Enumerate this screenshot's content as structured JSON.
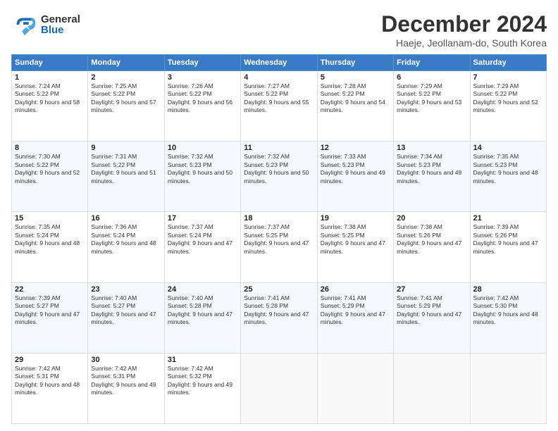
{
  "header": {
    "logo_general": "General",
    "logo_blue": "Blue",
    "main_title": "December 2024",
    "subtitle": "Haeje, Jeollanam-do, South Korea"
  },
  "weekdays": [
    "Sunday",
    "Monday",
    "Tuesday",
    "Wednesday",
    "Thursday",
    "Friday",
    "Saturday"
  ],
  "weeks": [
    [
      {
        "day": "1",
        "sunrise": "7:24 AM",
        "sunset": "5:22 PM",
        "daylight": "9 hours and 58 minutes."
      },
      {
        "day": "2",
        "sunrise": "7:25 AM",
        "sunset": "5:22 PM",
        "daylight": "9 hours and 57 minutes."
      },
      {
        "day": "3",
        "sunrise": "7:26 AM",
        "sunset": "5:22 PM",
        "daylight": "9 hours and 56 minutes."
      },
      {
        "day": "4",
        "sunrise": "7:27 AM",
        "sunset": "5:22 PM",
        "daylight": "9 hours and 55 minutes."
      },
      {
        "day": "5",
        "sunrise": "7:28 AM",
        "sunset": "5:22 PM",
        "daylight": "9 hours and 54 minutes."
      },
      {
        "day": "6",
        "sunrise": "7:29 AM",
        "sunset": "5:22 PM",
        "daylight": "9 hours and 53 minutes."
      },
      {
        "day": "7",
        "sunrise": "7:29 AM",
        "sunset": "5:22 PM",
        "daylight": "9 hours and 52 minutes."
      }
    ],
    [
      {
        "day": "8",
        "sunrise": "7:30 AM",
        "sunset": "5:22 PM",
        "daylight": "9 hours and 52 minutes."
      },
      {
        "day": "9",
        "sunrise": "7:31 AM",
        "sunset": "5:22 PM",
        "daylight": "9 hours and 51 minutes."
      },
      {
        "day": "10",
        "sunrise": "7:32 AM",
        "sunset": "5:23 PM",
        "daylight": "9 hours and 50 minutes."
      },
      {
        "day": "11",
        "sunrise": "7:32 AM",
        "sunset": "5:23 PM",
        "daylight": "9 hours and 50 minutes."
      },
      {
        "day": "12",
        "sunrise": "7:33 AM",
        "sunset": "5:23 PM",
        "daylight": "9 hours and 49 minutes."
      },
      {
        "day": "13",
        "sunrise": "7:34 AM",
        "sunset": "5:23 PM",
        "daylight": "9 hours and 49 minutes."
      },
      {
        "day": "14",
        "sunrise": "7:35 AM",
        "sunset": "5:23 PM",
        "daylight": "9 hours and 48 minutes."
      }
    ],
    [
      {
        "day": "15",
        "sunrise": "7:35 AM",
        "sunset": "5:24 PM",
        "daylight": "9 hours and 48 minutes."
      },
      {
        "day": "16",
        "sunrise": "7:36 AM",
        "sunset": "5:24 PM",
        "daylight": "9 hours and 48 minutes."
      },
      {
        "day": "17",
        "sunrise": "7:37 AM",
        "sunset": "5:24 PM",
        "daylight": "9 hours and 47 minutes."
      },
      {
        "day": "18",
        "sunrise": "7:37 AM",
        "sunset": "5:25 PM",
        "daylight": "9 hours and 47 minutes."
      },
      {
        "day": "19",
        "sunrise": "7:38 AM",
        "sunset": "5:25 PM",
        "daylight": "9 hours and 47 minutes."
      },
      {
        "day": "20",
        "sunrise": "7:38 AM",
        "sunset": "5:26 PM",
        "daylight": "9 hours and 47 minutes."
      },
      {
        "day": "21",
        "sunrise": "7:39 AM",
        "sunset": "5:26 PM",
        "daylight": "9 hours and 47 minutes."
      }
    ],
    [
      {
        "day": "22",
        "sunrise": "7:39 AM",
        "sunset": "5:27 PM",
        "daylight": "9 hours and 47 minutes."
      },
      {
        "day": "23",
        "sunrise": "7:40 AM",
        "sunset": "5:27 PM",
        "daylight": "9 hours and 47 minutes."
      },
      {
        "day": "24",
        "sunrise": "7:40 AM",
        "sunset": "5:28 PM",
        "daylight": "9 hours and 47 minutes."
      },
      {
        "day": "25",
        "sunrise": "7:41 AM",
        "sunset": "5:28 PM",
        "daylight": "9 hours and 47 minutes."
      },
      {
        "day": "26",
        "sunrise": "7:41 AM",
        "sunset": "5:29 PM",
        "daylight": "9 hours and 47 minutes."
      },
      {
        "day": "27",
        "sunrise": "7:41 AM",
        "sunset": "5:29 PM",
        "daylight": "9 hours and 47 minutes."
      },
      {
        "day": "28",
        "sunrise": "7:42 AM",
        "sunset": "5:30 PM",
        "daylight": "9 hours and 48 minutes."
      }
    ],
    [
      {
        "day": "29",
        "sunrise": "7:42 AM",
        "sunset": "5:31 PM",
        "daylight": "9 hours and 48 minutes."
      },
      {
        "day": "30",
        "sunrise": "7:42 AM",
        "sunset": "5:31 PM",
        "daylight": "9 hours and 49 minutes."
      },
      {
        "day": "31",
        "sunrise": "7:42 AM",
        "sunset": "5:32 PM",
        "daylight": "9 hours and 49 minutes."
      },
      null,
      null,
      null,
      null
    ]
  ]
}
